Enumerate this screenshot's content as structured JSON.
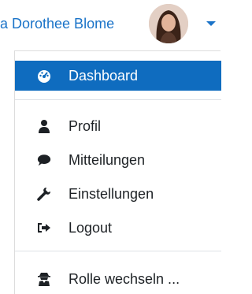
{
  "user": {
    "name": "a Dorothee Blome"
  },
  "menu": {
    "dashboard": "Dashboard",
    "profile": "Profil",
    "messages": "Mitteilungen",
    "preferences": "Einstellungen",
    "logout": "Logout",
    "switch_role": "Rolle wechseln ..."
  },
  "colors": {
    "accent": "#0f6cbf",
    "link": "#1a73c8",
    "text": "#1d2125"
  }
}
